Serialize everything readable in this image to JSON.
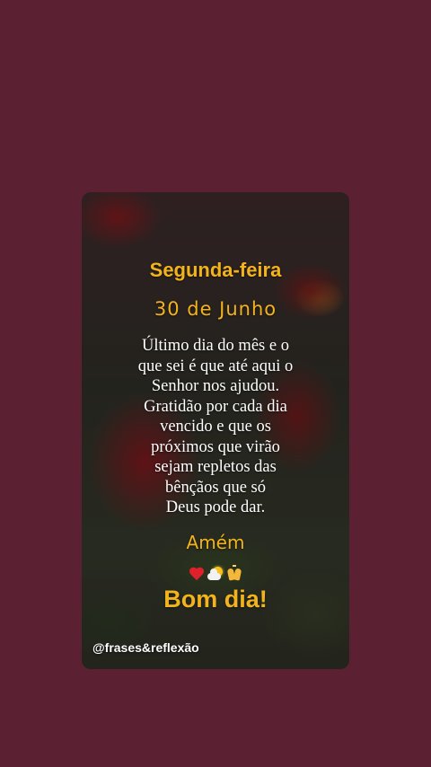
{
  "colors": {
    "background": "#5b2133",
    "accent": "#f2b31c",
    "text": "#ffffff"
  },
  "post": {
    "weekday": "Segunda-feira",
    "date": "30 de Junho",
    "message_lines": [
      "Último dia do mês e o",
      "que sei é que até aqui o",
      "Senhor nos ajudou.",
      "Gratidão por cada dia",
      "vencido e que os",
      "próximos que virão",
      "sejam repletos das",
      "bênçãos que só",
      "Deus pode dar."
    ],
    "closing": "Amém",
    "emojis": [
      "red-heart",
      "sun-behind-cloud",
      "raised-hands"
    ],
    "greeting": "Bom dia!",
    "handle": "@frases&reflexão"
  }
}
